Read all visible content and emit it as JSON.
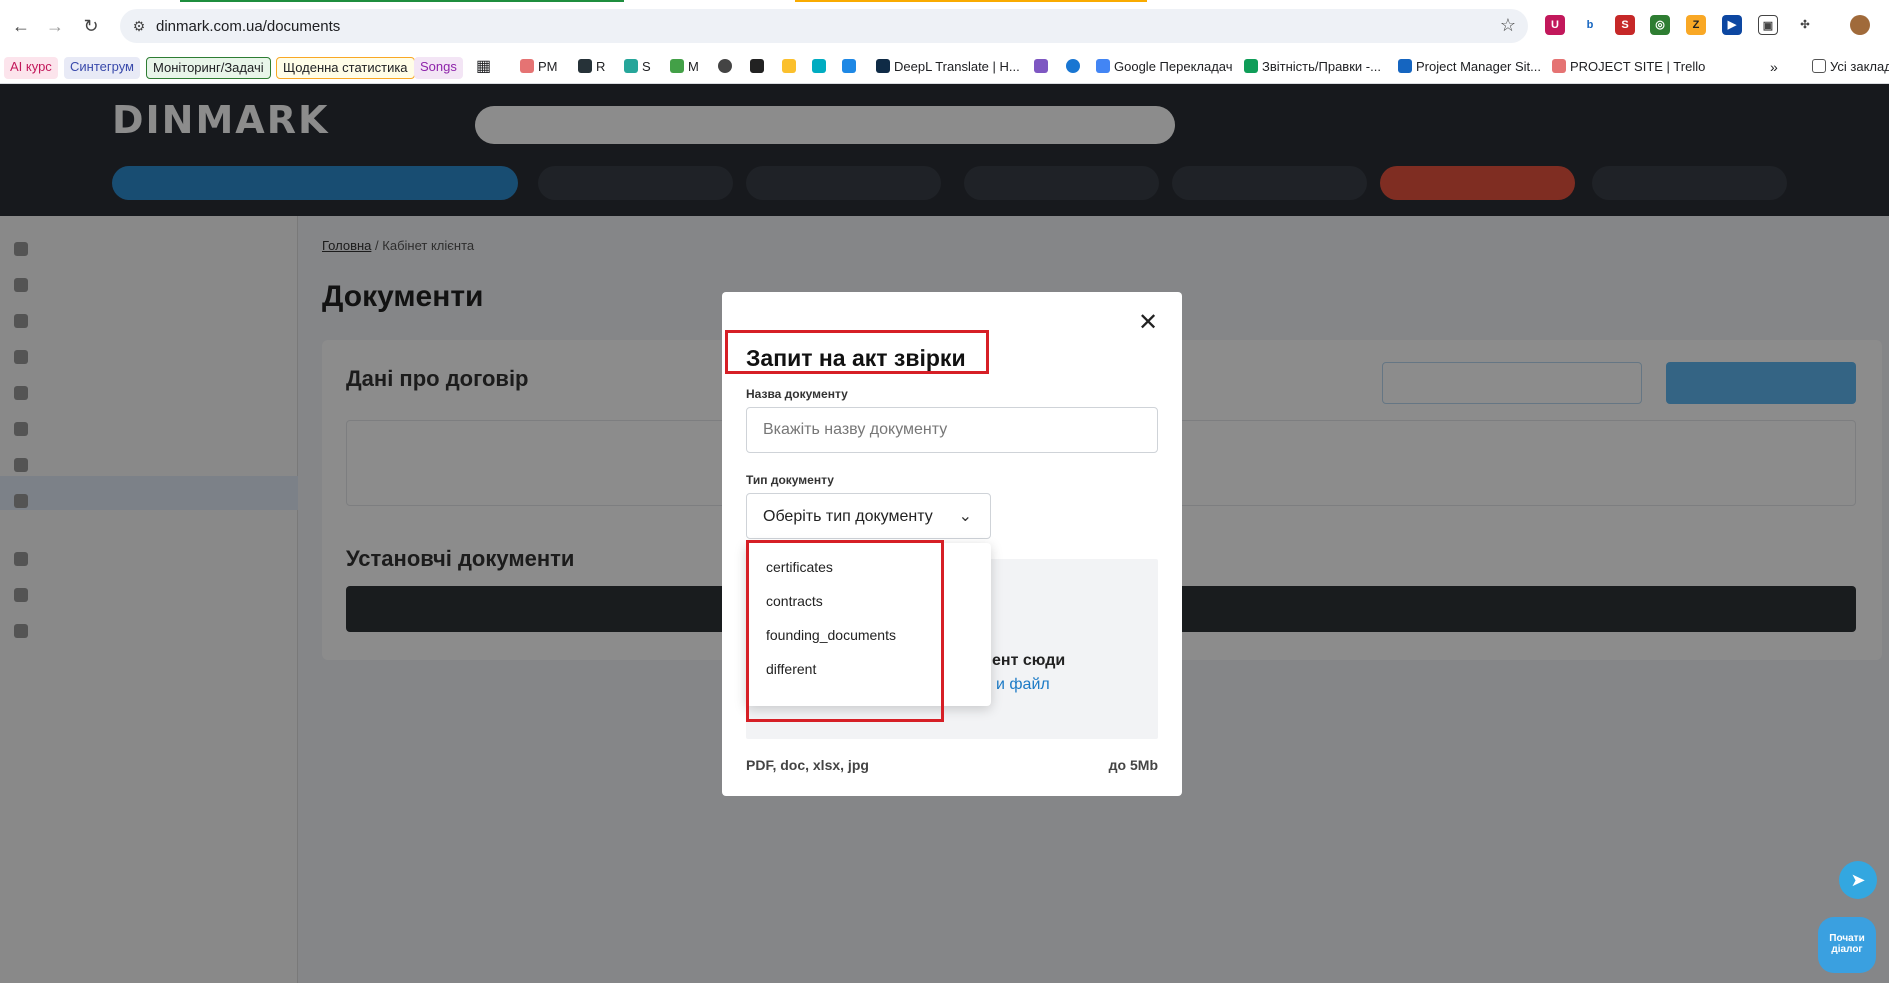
{
  "browser": {
    "url": "dinmark.com.ua/documents",
    "bookmarks": [
      "AI курс",
      "Синтегрум",
      "Моніторинг/Задачі",
      "Щоденна статистика",
      "Songs",
      "PM",
      "R",
      "S",
      "M",
      "DeepL Translate | H...",
      "Google Перекладач",
      "Звітність/Правки -...",
      "Project Manager Sit...",
      "PROJECT SITE | Trello",
      "Усі заклад"
    ]
  },
  "site": {
    "logo": "DINMARK",
    "breadcrumb_home": "Головна",
    "breadcrumb_current": "Кабінет клієнта",
    "page_title": "Документи",
    "section_contract": "Дані про договір",
    "section_founding": "Установчі документи"
  },
  "modal": {
    "title": "Запит на акт звірки",
    "name_label": "Назва документу",
    "name_placeholder": "Вкажіть назву документу",
    "type_label": "Тип документу",
    "type_selected": "Оберіть тип документу",
    "type_options": [
      "certificates",
      "contracts",
      "founding_documents",
      "different"
    ],
    "dropzone_title": "ент сюди",
    "dropzone_link": "и файл",
    "formats": "PDF, doc, xlsx, jpg",
    "max_size": "до 5Mb"
  },
  "chat": {
    "start_label": "Почати діалог"
  },
  "colors": {
    "highlight": "#d61f26",
    "link": "#1d7bc6",
    "brand_blue": "#2d8ccf"
  }
}
